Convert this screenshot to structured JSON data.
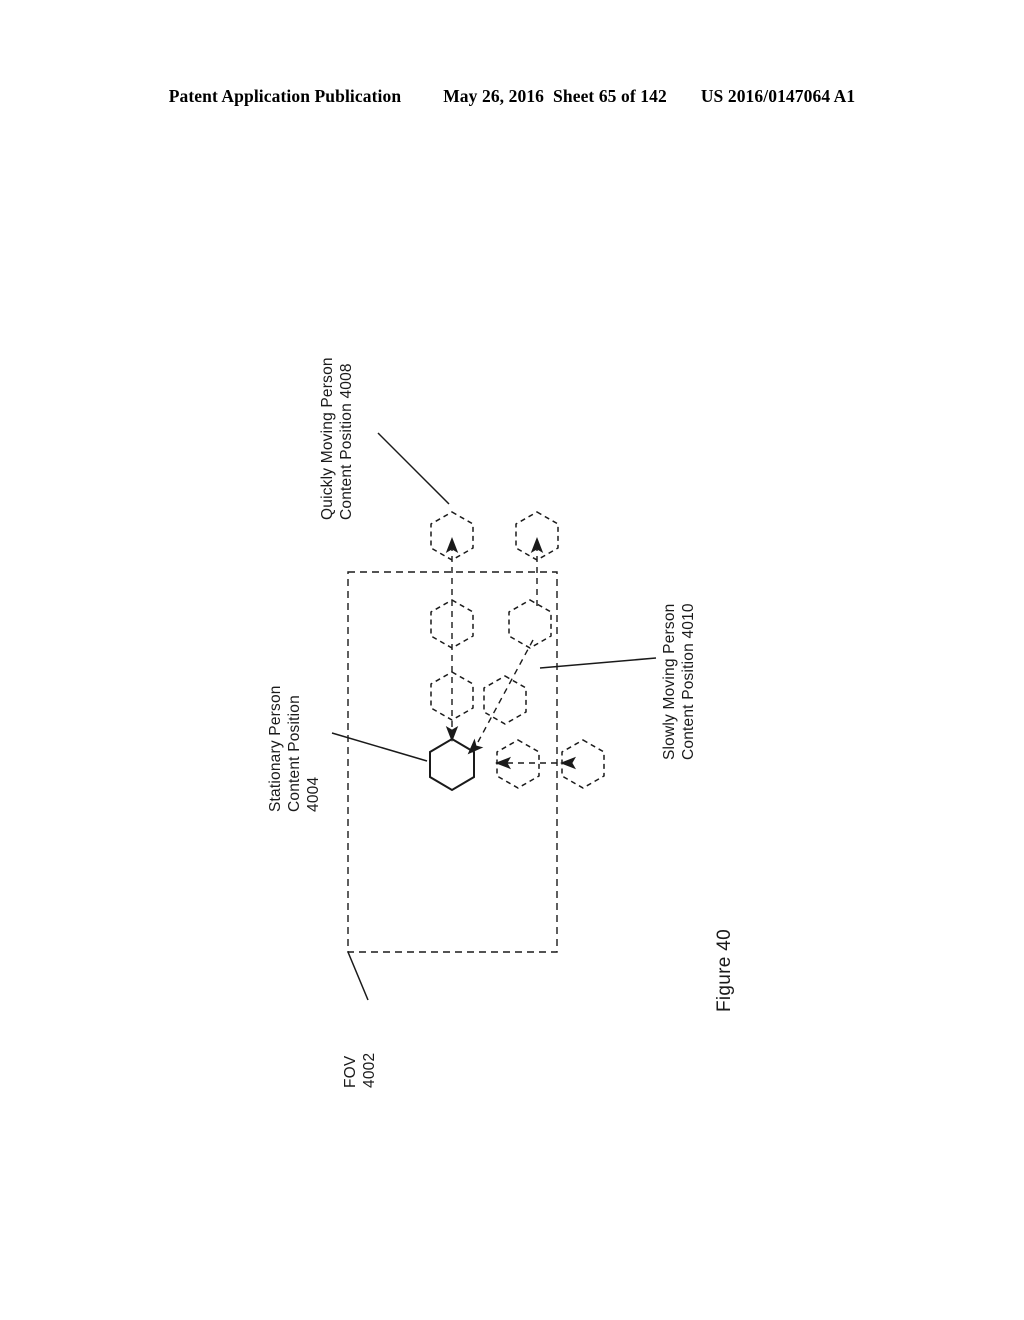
{
  "header": {
    "publication": "Patent Application Publication",
    "date": "May 26, 2016",
    "sheet": "Sheet 65 of 142",
    "patent_number": "US 2016/0147064 A1"
  },
  "figure": {
    "caption": "Figure 40",
    "labels": {
      "quickly_moving": {
        "line1": "Quickly Moving Person",
        "line2": "Content Position 4008"
      },
      "stationary": {
        "line1": "Stationary Person",
        "line2": "Content Position",
        "line3": "4004"
      },
      "slowly_moving": {
        "line1": "Slowly Moving Person",
        "line2": "Content Position 4010"
      },
      "fov": {
        "line1": "FOV",
        "line2": "4002"
      }
    },
    "reference_numerals": [
      "4002",
      "4004",
      "4008",
      "4010"
    ],
    "colors": {
      "stroke": "#1a1a1a",
      "background": "#ffffff"
    }
  }
}
